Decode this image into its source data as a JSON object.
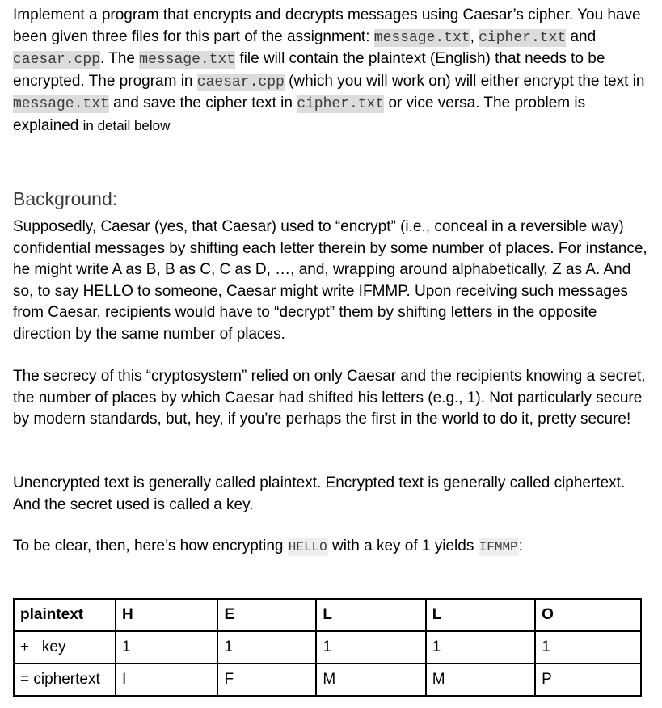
{
  "intro": {
    "t1": "Implement a program that encrypts and decrypts messages using Caesar’s cipher. You have been given three files for this part of the assignment: ",
    "file_message": "message.txt",
    "t2": ",",
    "file_cipher": "cipher.txt",
    "t3": " and ",
    "file_caesar": "caesar.cpp",
    "t4": ". The ",
    "file_message_2": "message.txt",
    "t5": " file will contain the plaintext (English) that needs to be encrypted. The program in ",
    "file_caesar_2": "caesar.cpp",
    "t6": " (which you will work on) will either encrypt the text in ",
    "file_message_3": "message.txt",
    "t7": " and save the cipher text in ",
    "file_cipher_2": "cipher.txt",
    "t8": " or vice versa. The problem is explained ",
    "t9": "in detail below"
  },
  "background": {
    "heading": "Background:",
    "p1": "Supposedly, Caesar (yes, that Caesar) used to “encrypt” (i.e., conceal in a reversible way) confidential messages by shifting each letter therein by some number of places. For instance, he might write A as B, B as C, C as D, …, and, wrapping around alphabetically, Z as A. And so, to say HELLO to someone, Caesar might write IFMMP. Upon receiving such messages from Caesar, recipients would have to “decrypt” them by shifting letters in the opposite direction by the same number of places.",
    "p2": "The secrecy of this “cryptosystem” relied on only Caesar and the recipients knowing a secret, the number of places by which Caesar had shifted his letters (e.g., 1). Not particularly secure by modern standards, but, hey, if you’re perhaps the first in the world to do it, pretty secure!",
    "p3": "Unencrypted text is generally called plaintext. Encrypted text is generally called ciphertext. And the secret used is called a key.",
    "p4_a": "To be clear, then, here’s how encrypting ",
    "p4_code1": "HELLO",
    "p4_b": " with a key of 1 yields ",
    "p4_code2": "IFMMP",
    "p4_c": ":"
  },
  "table": {
    "rows": [
      {
        "label": "plaintext",
        "cells": [
          "H",
          "E",
          "L",
          "L",
          "O"
        ]
      },
      {
        "label": "+   key",
        "cells": [
          "1",
          "1",
          "1",
          "1",
          "1"
        ]
      },
      {
        "label": "= ciphertext",
        "cells": [
          "I",
          "F",
          "M",
          "M",
          "P"
        ]
      }
    ]
  }
}
